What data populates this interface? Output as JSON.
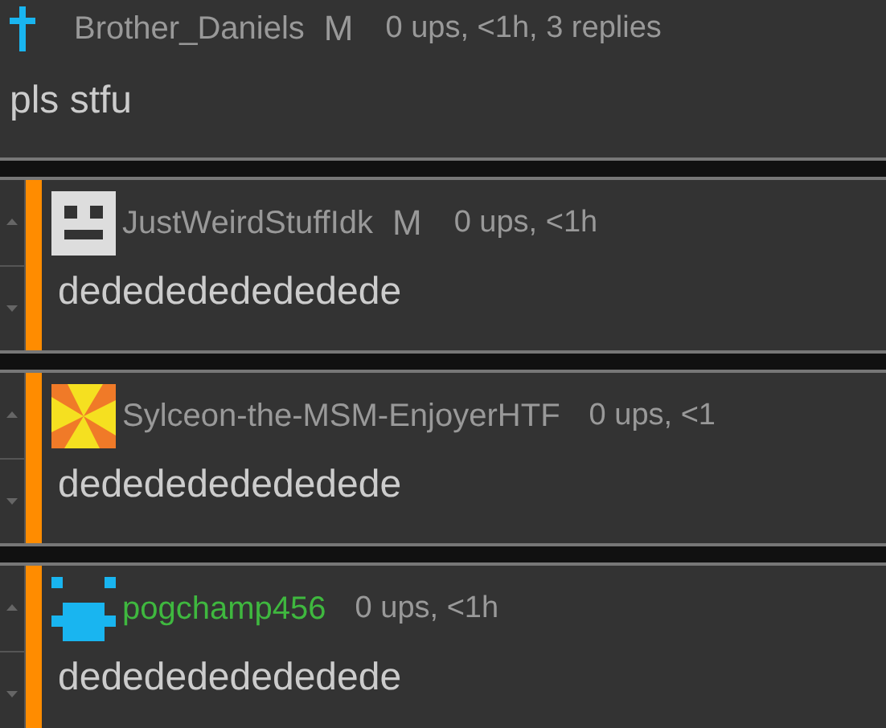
{
  "comment": {
    "user": {
      "name": "Brother_Daniels",
      "avatar": {
        "kind": "cross"
      },
      "badge": "M"
    },
    "meta": "0 ups, <1h, 3 replies",
    "body": "pls stfu"
  },
  "replies": [
    {
      "user": {
        "name": "JustWeirdStuffIdk",
        "avatar": {
          "kind": "face"
        },
        "badge": "M",
        "color": "#999999"
      },
      "meta": "0 ups, <1h",
      "body": "dededededededede"
    },
    {
      "user": {
        "name": "Sylceon-the-MSM-EnjoyerHTF",
        "avatar": {
          "kind": "pinwheel"
        },
        "color": "#999999"
      },
      "meta": "0 ups, <1",
      "body": "dededededededede"
    },
    {
      "user": {
        "name": "pogchamp456",
        "avatar": {
          "kind": "creature"
        },
        "color": "#3fb83f"
      },
      "meta": "0 ups, <1h",
      "body": "dededededededede"
    }
  ]
}
